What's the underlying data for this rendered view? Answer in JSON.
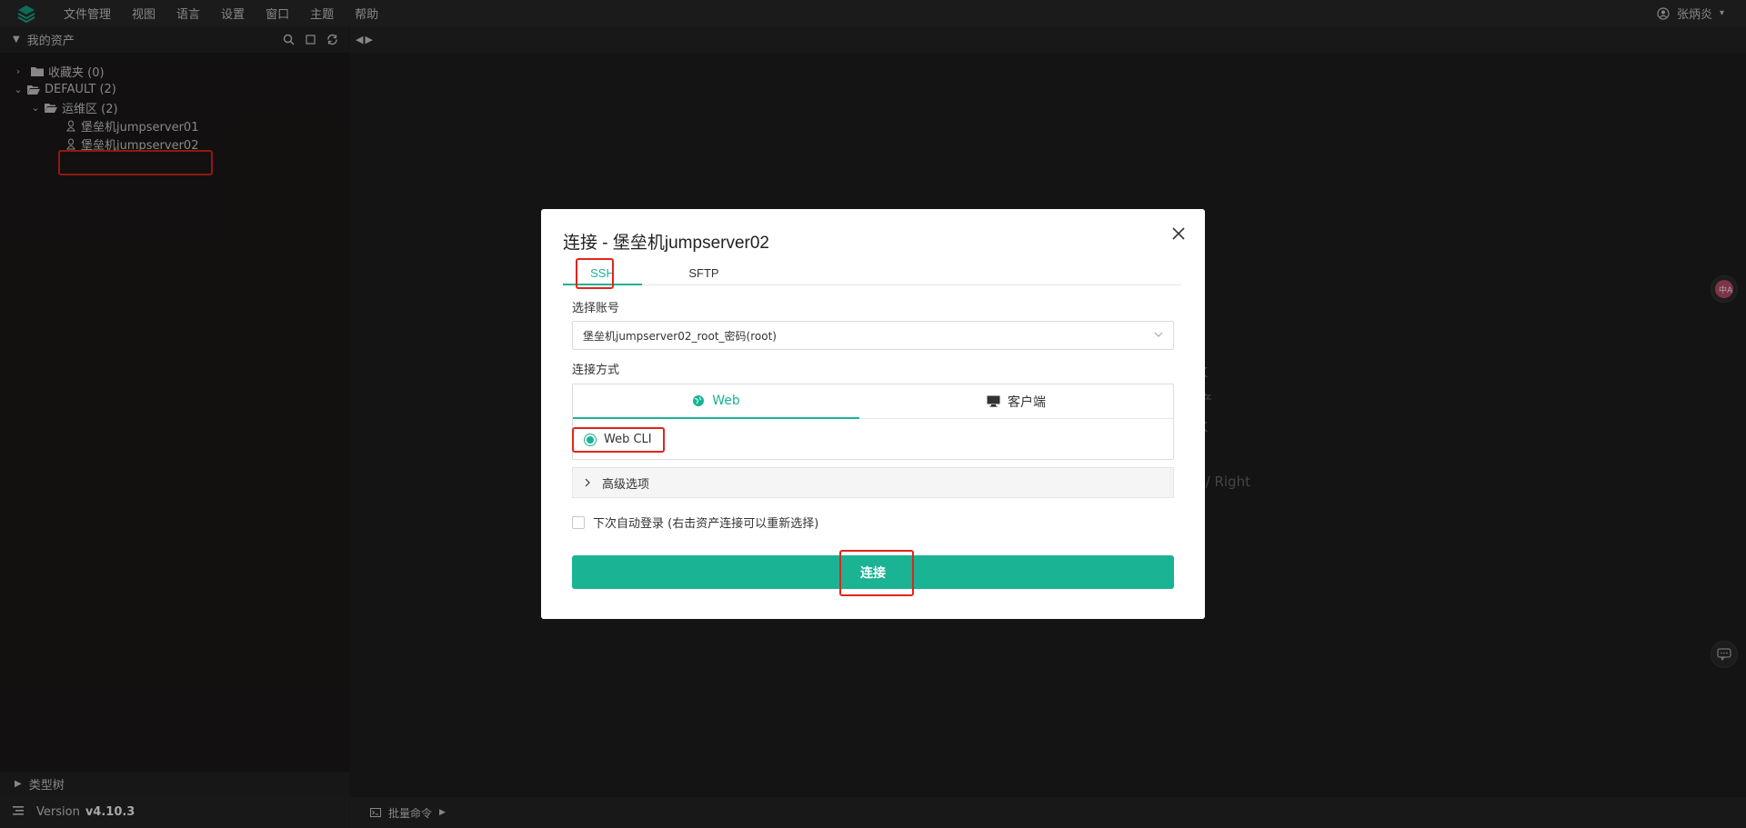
{
  "menubar": {
    "items": [
      "文件管理",
      "视图",
      "语言",
      "设置",
      "窗口",
      "主题",
      "帮助"
    ],
    "user": "张炳炎"
  },
  "sidebar": {
    "title": "我的资产",
    "tree": {
      "favorites": "收藏夹 (0)",
      "default": "DEFAULT (2)",
      "ops": "运维区 (2)",
      "hosts": [
        "堡垒机jumpserver01",
        "堡垒机jumpserver02"
      ]
    },
    "type_tree": "类型树",
    "version_label": "Version",
    "version": "v4.10.3"
  },
  "main": {
    "hint_fragments": [
      "K",
      "产",
      "K",
      "t / Right"
    ],
    "bottom_bar": "批量命令"
  },
  "modal": {
    "title": "连接 - 堡垒机jumpserver02",
    "tabs": [
      "SSH",
      "SFTP"
    ],
    "account_label": "选择账号",
    "account_value": "堡垒机jumpserver02_root_密码(root)",
    "method_label": "连接方式",
    "method_tabs": [
      "Web",
      "客户端"
    ],
    "web_option": "Web CLI",
    "advanced": "高级选项",
    "auto_login": "下次自动登录 (右击资产连接可以重新选择)",
    "connect_button": "连接"
  },
  "colors": {
    "accent": "#1ab394",
    "highlight": "#e1251b"
  }
}
